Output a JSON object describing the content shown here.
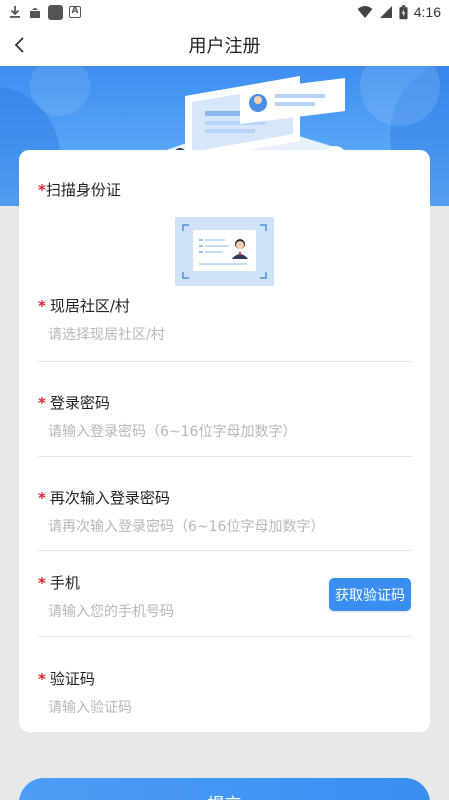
{
  "status_bar": {
    "time": "4:16",
    "icons": [
      "download-icon",
      "android-icon",
      "square-app-icon",
      "a-icon",
      "wifi-icon",
      "signal-icon",
      "battery-icon"
    ]
  },
  "nav": {
    "title": "用户注册",
    "back_icon": "chevron-left-icon"
  },
  "form": {
    "scan_id": {
      "label": "扫描身份证"
    },
    "community": {
      "label": "现居社区/村",
      "placeholder": "请选择现居社区/村"
    },
    "password": {
      "label": "登录密码",
      "placeholder": "请输入登录密码（6~16位字母加数字）"
    },
    "password_confirm": {
      "label": "再次输入登录密码",
      "placeholder": "请再次输入登录密码（6~16位字母加数字）"
    },
    "phone": {
      "label": "手机",
      "placeholder": "请输入您的手机号码",
      "code_button": "获取验证码"
    },
    "verify_code": {
      "label": "验证码",
      "placeholder": "请输入验证码"
    },
    "required_mark": "*"
  },
  "submit": {
    "label": "提交"
  },
  "colors": {
    "accent": "#3a8ef2",
    "required": "#d9242a",
    "placeholder": "#b7b7b7",
    "background": "#e8e8e8"
  }
}
